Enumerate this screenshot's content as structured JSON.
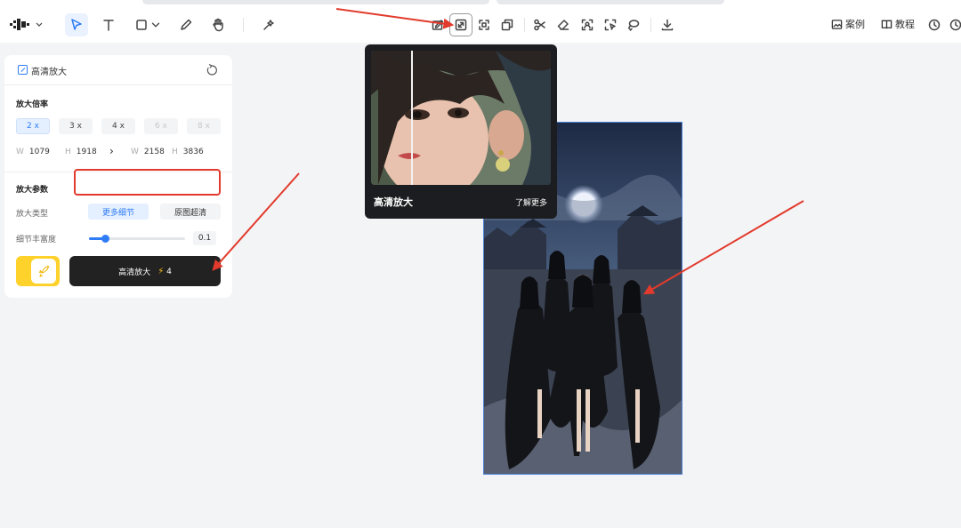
{
  "toolbar": {
    "tools": [
      "select-tool",
      "text-tool",
      "rectangle-tool",
      "pen-tool",
      "hand-tool",
      "ai-tool"
    ],
    "image_tools": [
      "image-edit",
      "upscale",
      "expand",
      "layers",
      "cut",
      "eraser",
      "recognize",
      "smart-select",
      "lasso",
      "download"
    ],
    "cases_label": "案例",
    "tutorial_label": "教程"
  },
  "panel": {
    "title": "高清放大",
    "scale_section": "放大倍率",
    "scale_options": [
      "2 x",
      "3 x",
      "4 x",
      "6 x",
      "8 x"
    ],
    "selected_scale": "2 x",
    "source": {
      "w_label": "W",
      "w": "1079",
      "h_label": "H",
      "h": "1918"
    },
    "target": {
      "w_label": "W",
      "w": "2158",
      "h_label": "H",
      "h": "3836"
    },
    "params_section": "放大参数",
    "type_label": "放大类型",
    "type_options": [
      "更多细节",
      "原图超清"
    ],
    "selected_type": "更多细节",
    "detail_label": "细节丰富度",
    "detail_value": "0.1",
    "detail_fraction": 0.17,
    "action_label": "高清放大",
    "cost": "4"
  },
  "popover": {
    "title": "高清放大",
    "link": "了解更多"
  },
  "colors": {
    "accent": "#2f7cf6",
    "annotation": "#e23a2c",
    "yellow": "#ffd12b"
  }
}
